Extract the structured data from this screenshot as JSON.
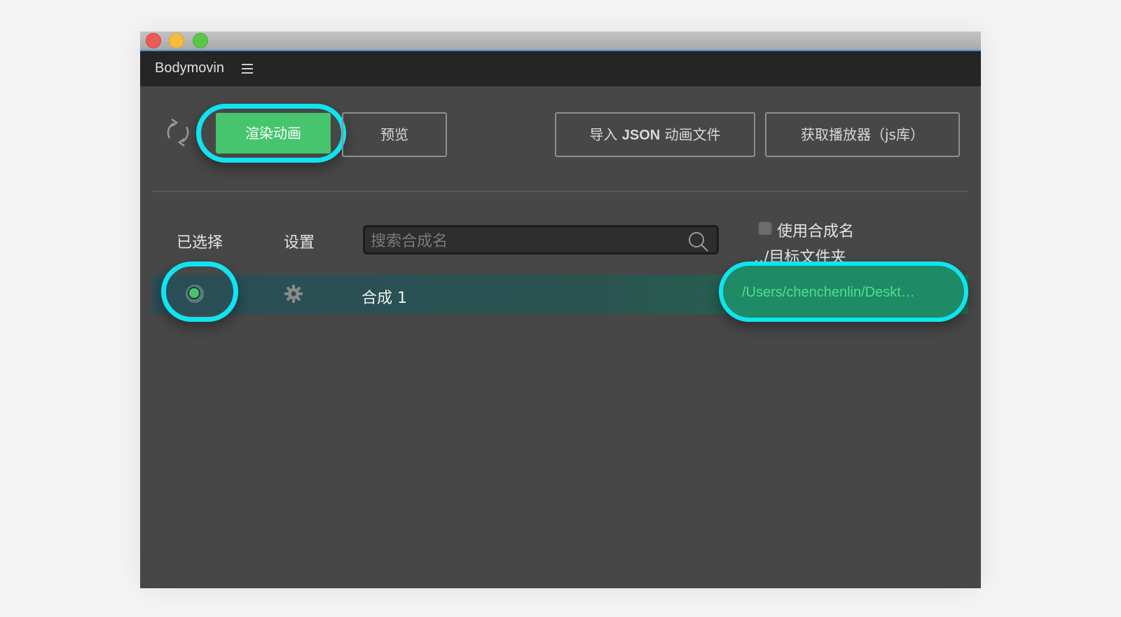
{
  "window": {
    "traffic_lights": [
      "close",
      "minimize",
      "zoom"
    ]
  },
  "panel": {
    "title": "Bodymovin",
    "menu_icon": "hamburger-menu-icon"
  },
  "toolbar": {
    "refresh_icon": "refresh-icon",
    "render_label": "渲染动画",
    "preview_label": "预览",
    "import_prefix": "导入 ",
    "import_bold": "JSON",
    "import_suffix": " 动画文件",
    "player_label": "获取播放器（js库）"
  },
  "list_header": {
    "selected_label": "已选择",
    "settings_label": "设置",
    "search_placeholder": "搜索合成名",
    "search_value": "",
    "use_comp_name_label": "使用合成名",
    "use_comp_name_checked": false,
    "destination_label": "../目标文件夹"
  },
  "compositions": [
    {
      "selected": true,
      "name": "合成 1",
      "destination": "/Users/chenchenlin/Deskt…"
    }
  ],
  "colors": {
    "accent_green": "#46c46e",
    "highlight_cyan": "#10e4f0",
    "panel_bg": "#474747",
    "header_bg": "#252525",
    "path_text": "#4fe08a"
  }
}
